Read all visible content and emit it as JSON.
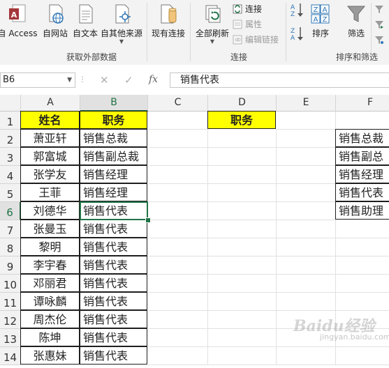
{
  "ribbon": {
    "get_external_data": {
      "group_label": "获取外部数据",
      "buttons": [
        {
          "label": "自 Access",
          "icon": "access-icon"
        },
        {
          "label": "自网站",
          "icon": "web-icon"
        },
        {
          "label": "自文本",
          "icon": "text-file-icon"
        },
        {
          "label": "自其他来源",
          "icon": "other-sources-icon"
        },
        {
          "label": "现有连接",
          "icon": "existing-connections-icon"
        }
      ]
    },
    "connections": {
      "group_label": "连接",
      "refresh_all": "全部刷新",
      "items": [
        {
          "label": "连接",
          "icon": "connections-icon"
        },
        {
          "label": "属性",
          "icon": "properties-icon"
        },
        {
          "label": "编辑链接",
          "icon": "edit-links-icon"
        }
      ]
    },
    "sort_filter": {
      "group_label": "排序和筛选",
      "sort_az_icon": "sort-ascending-icon",
      "sort_za_icon": "sort-descending-icon",
      "sort": "排序",
      "filter": "筛选"
    }
  },
  "formula_bar": {
    "name_box": "B6",
    "cancel": "✕",
    "enter": "✓",
    "fx": "fx",
    "content": "销售代表"
  },
  "grid": {
    "columns": [
      "A",
      "B",
      "C",
      "D",
      "E",
      "F"
    ],
    "selected_column": "B",
    "rows": [
      "1",
      "2",
      "3",
      "4",
      "5",
      "6",
      "7",
      "8",
      "9",
      "10",
      "11",
      "12",
      "13",
      "14"
    ],
    "selected_row": "6",
    "A": [
      "姓名",
      "萧亚轩",
      "郭富城",
      "张学友",
      "王菲",
      "刘德华",
      "张曼玉",
      "黎明",
      "李宇春",
      "邓丽君",
      "谭咏麟",
      "周杰伦",
      "陈坤",
      "张惠妹"
    ],
    "B": [
      "职务",
      "销售总裁",
      "销售副总裁",
      "销售经理",
      "销售经理",
      "销售代表",
      "销售代表",
      "销售代表",
      "销售代表",
      "销售代表",
      "销售代表",
      "销售代表",
      "销售代表",
      "销售代表"
    ],
    "D1": "职务",
    "F": [
      "销售总裁",
      "销售副总",
      "销售经理",
      "销售代表",
      "销售助理"
    ]
  },
  "watermark": {
    "text": "Baidu经验",
    "sub": "jingyan.baidu.com"
  },
  "colors": {
    "header_yellow": "#ffff00",
    "selection_green": "#217346",
    "ribbon_bg": "#f3f3f3"
  }
}
